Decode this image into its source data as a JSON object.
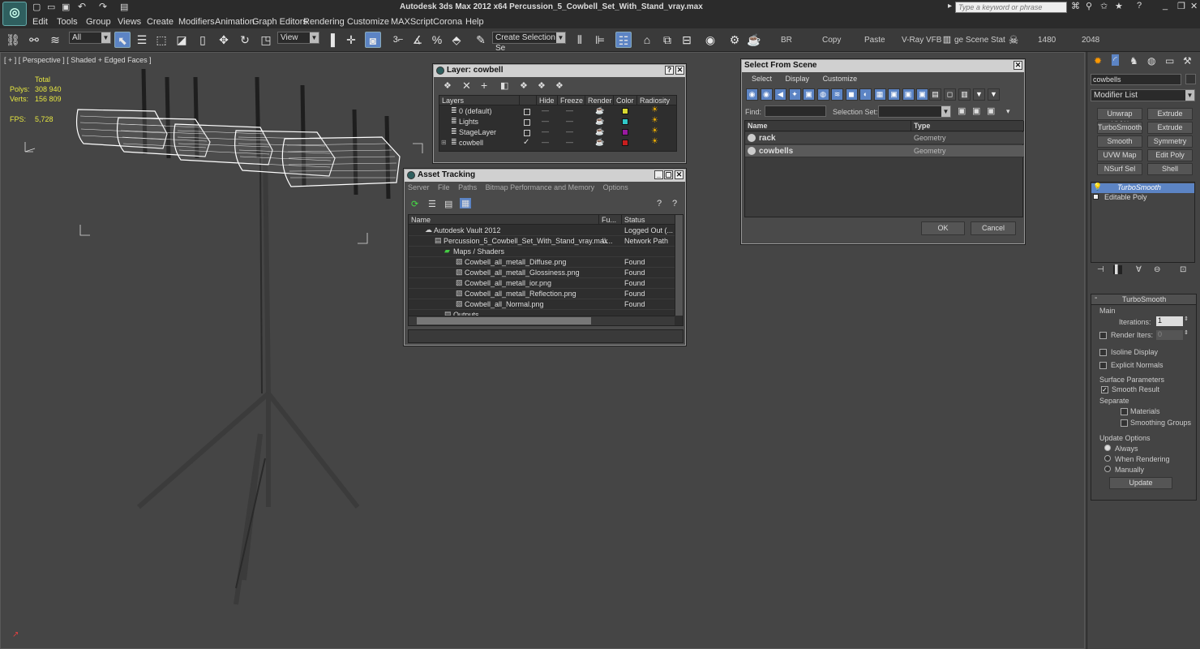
{
  "app": {
    "title": "Autodesk 3ds Max  2012 x64    Percussion_5_Cowbell_Set_With_Stand_vray.max",
    "search_placeholder": "Type a keyword or phrase",
    "logo": "3ds-max-logo"
  },
  "menu": [
    "Edit",
    "Tools",
    "Group",
    "Views",
    "Create",
    "Modifiers",
    "Animation",
    "Graph Editors",
    "Rendering",
    "Customize",
    "MAXScript",
    "Corona",
    "Help"
  ],
  "toolbar": {
    "filter": "All",
    "refcoord": "View",
    "selset": "Create Selection Se",
    "text_items": [
      "BR",
      "Copy",
      "Paste",
      "V-Ray VFB",
      "ge Scene Stat",
      "1480",
      "2048"
    ]
  },
  "viewport": {
    "label": "[ + ] [ Perspective ] [ Shaded + Edged Faces ]",
    "stats": {
      "total_label": "Total",
      "polys_label": "Polys:",
      "polys": "308 940",
      "verts_label": "Verts:",
      "verts": "156 809",
      "fps_label": "FPS:",
      "fps": "5,728"
    }
  },
  "layer_window": {
    "title": "Layer: cowbell",
    "cols": [
      "Layers",
      "Hide",
      "Freeze",
      "Render",
      "Color",
      "Radiosity"
    ],
    "rows": [
      {
        "name": "0 (default)",
        "color": "#d8d830"
      },
      {
        "name": "Lights",
        "color": "#30c8c8"
      },
      {
        "name": "StageLayer",
        "color": "#9a1aa0"
      },
      {
        "name": "cowbell",
        "color": "#c81e1e"
      }
    ]
  },
  "asset_tracking": {
    "title": "Asset Tracking",
    "menu": [
      "Server",
      "File",
      "Paths",
      "Bitmap Performance and Memory",
      "Options"
    ],
    "cols": [
      "Name",
      "Fu...",
      "Status"
    ],
    "rows": [
      {
        "name": "Autodesk Vault 2012",
        "full": "",
        "status": "Logged Out (..."
      },
      {
        "name": "Percussion_5_Cowbell_Set_With_Stand_vray.max",
        "full": "\\\\...",
        "status": "Network Path"
      },
      {
        "name": "Maps / Shaders",
        "full": "",
        "status": ""
      },
      {
        "name": "Cowbell_all_metall_Diffuse.png",
        "full": "",
        "status": "Found"
      },
      {
        "name": "Cowbell_all_metall_Glossiness.png",
        "full": "",
        "status": "Found"
      },
      {
        "name": "Cowbell_all_metall_ior.png",
        "full": "",
        "status": "Found"
      },
      {
        "name": "Cowbell_all_metall_Reflection.png",
        "full": "",
        "status": "Found"
      },
      {
        "name": "Cowbell_all_Normal.png",
        "full": "",
        "status": "Found"
      },
      {
        "name": "Outputs",
        "full": "",
        "status": ""
      }
    ]
  },
  "select_from_scene": {
    "title": "Select From Scene",
    "menu": [
      "Select",
      "Display",
      "Customize"
    ],
    "find_label": "Find:",
    "selset_label": "Selection Set:",
    "cols": [
      "Name",
      "Type"
    ],
    "rows": [
      {
        "name": "rack",
        "type": "Geometry"
      },
      {
        "name": "cowbells",
        "type": "Geometry"
      }
    ],
    "ok": "OK",
    "cancel": "Cancel"
  },
  "command_panel": {
    "object_name": "cowbells",
    "modifier_list": "Modifier List",
    "buttons": [
      "Unwrap UVW",
      "Extrude",
      "TurboSmooth",
      "Extrude",
      "Smooth",
      "Symmetry",
      "UVW Map",
      "Edit Poly",
      "NSurf Sel",
      "Shell"
    ],
    "stack": [
      "TurboSmooth",
      "Editable Poly"
    ],
    "rollout_title": "TurboSmooth",
    "main_label": "Main",
    "iterations_label": "Iterations:",
    "iterations": "1",
    "render_iters_label": "Render Iters:",
    "render_iters": "0",
    "isoline": "Isoline Display",
    "explicit": "Explicit Normals",
    "surface_label": "Surface Parameters",
    "smooth_result": "Smooth Result",
    "separate": "Separate",
    "materials": "Materials",
    "smoothing_groups": "Smoothing Groups",
    "update_options": "Update Options",
    "always": "Always",
    "when_rendering": "When Rendering",
    "manually": "Manually",
    "update": "Update"
  }
}
